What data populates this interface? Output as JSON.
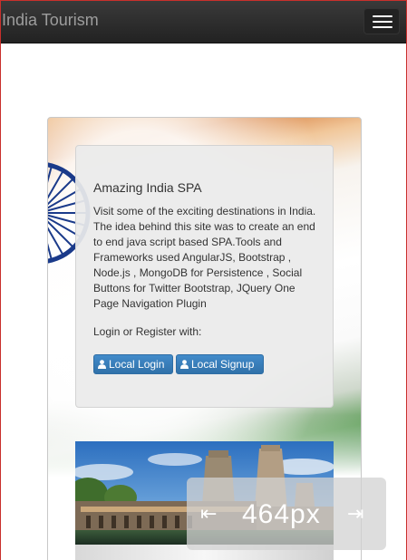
{
  "navbar": {
    "brand": "India Tourism",
    "menu_icon": "hamburger-menu-icon"
  },
  "card": {
    "title": "Amazing India SPA",
    "description": "Visit some of the exciting destinations in India. The idea behind this site was to create an end to end java script based SPA.Tools and Frameworks used AngularJS, Bootstrap , Node.js , MongoDB for Persistence , Social Buttons for Twitter Bootstrap, JQuery One Page Navigation Plugin",
    "login_prompt": "Login or Register with:",
    "login_button": "Local Login",
    "signup_button": "Local Signup",
    "button_icon": "user-icon"
  },
  "overlay": {
    "width_label": "464px",
    "left_arrow": "⇤",
    "right_arrow": "⇥"
  },
  "colors": {
    "navbar": "#222222",
    "button_primary": "#428bca",
    "saffron": "#e59b4f",
    "green": "#2f7d35"
  }
}
